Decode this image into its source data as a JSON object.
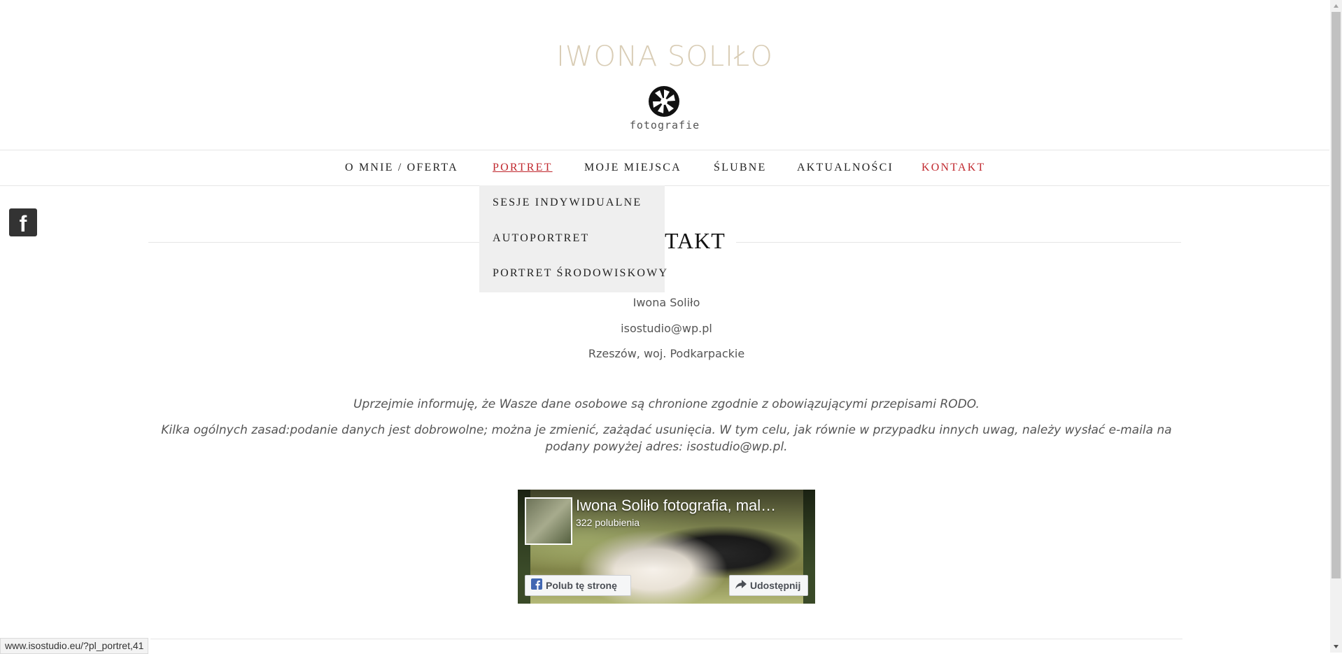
{
  "header": {
    "logo_text": "IWONA SOLIŁO",
    "logo_sub": "fotografie"
  },
  "nav": {
    "items": [
      {
        "label": "O MNIE / OFERTA"
      },
      {
        "label": "PORTRET"
      },
      {
        "label": "MOJE MIEJSCA"
      },
      {
        "label": "ŚLUBNE"
      },
      {
        "label": "AKTUALNOŚCI"
      },
      {
        "label": "KONTAKT"
      }
    ],
    "active": "PORTRET",
    "current_page": "KONTAKT"
  },
  "dropdown": {
    "items": [
      {
        "label": "SESJE INDYWIDUALNE"
      },
      {
        "label": "AUTOPORTRET"
      },
      {
        "label": "PORTRET ŚRODOWISKOWY"
      }
    ]
  },
  "page": {
    "title_visible": "TAKT"
  },
  "contact": {
    "name": "Iwona Soliło",
    "email": "isostudio@wp.pl",
    "location": "Rzeszów, woj. Podkarpackie"
  },
  "info": {
    "line1": "Uprzejmie informuję, że Wasze dane osobowe są chronione zgodnie z obowiązującymi przepisami RODO.",
    "line2": "Kilka ogólnych zasad:podanie danych jest dobrowolne; można je zmienić, zażądać usunięcia. W tym celu, jak równie w przypadku innych uwag, należy wysłać e-maila na podany powyżej adres: isostudio@wp.pl."
  },
  "fb_widget": {
    "page_name": "Iwona Soliło fotografia, mal…",
    "likes": "322 polubienia",
    "like_button": "Polub tę stronę",
    "share_button": "Udostępnij"
  },
  "status_bar": {
    "url": "www.isostudio.eu/?pl_portret,41"
  },
  "colors": {
    "accent_red": "#c0272d",
    "logo_beige": "#d9cdb6",
    "dropdown_bg": "#efefef"
  },
  "icons": [
    "aperture-logo-icon",
    "facebook-icon",
    "facebook-like-icon",
    "share-icon"
  ]
}
